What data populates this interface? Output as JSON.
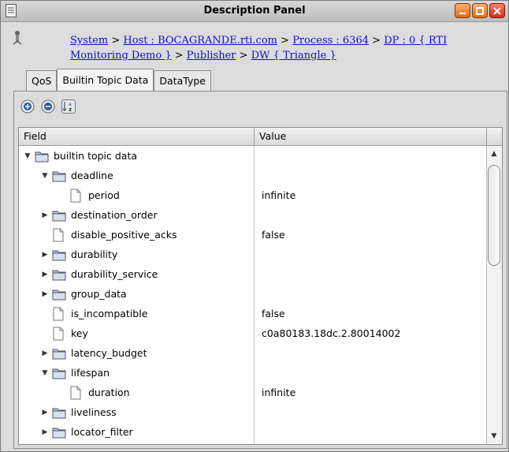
{
  "window": {
    "title": "Description Panel"
  },
  "breadcrumb": {
    "items": [
      "System",
      "Host : BOCAGRANDE.rti.com",
      "Process : 6364",
      "DP : 0 { RTI Monitoring Demo }",
      "Publisher",
      "DW { Triangle }"
    ],
    "separator": ">"
  },
  "tabs": [
    {
      "label": "QoS",
      "active": false
    },
    {
      "label": "Builtin Topic Data",
      "active": true
    },
    {
      "label": "DataType",
      "active": false
    }
  ],
  "toolbar": {
    "expand_icon": "plus-circle-icon",
    "collapse_icon": "minus-circle-icon",
    "sort_icon": "sort-az-icon"
  },
  "table": {
    "columns": [
      "Field",
      "Value"
    ],
    "rows": [
      {
        "indent": 0,
        "toggle": "expanded",
        "icon": "folder-icon",
        "field": "builtin topic data",
        "value": ""
      },
      {
        "indent": 1,
        "toggle": "expanded",
        "icon": "folder-icon",
        "field": "deadline",
        "value": ""
      },
      {
        "indent": 2,
        "toggle": "none",
        "icon": "file-icon",
        "field": "period",
        "value": "infinite"
      },
      {
        "indent": 1,
        "toggle": "collapsed",
        "icon": "folder-icon",
        "field": "destination_order",
        "value": ""
      },
      {
        "indent": 1,
        "toggle": "none",
        "icon": "file-icon",
        "field": "disable_positive_acks",
        "value": "false"
      },
      {
        "indent": 1,
        "toggle": "collapsed",
        "icon": "folder-icon",
        "field": "durability",
        "value": ""
      },
      {
        "indent": 1,
        "toggle": "collapsed",
        "icon": "folder-icon",
        "field": "durability_service",
        "value": ""
      },
      {
        "indent": 1,
        "toggle": "collapsed",
        "icon": "folder-icon",
        "field": "group_data",
        "value": ""
      },
      {
        "indent": 1,
        "toggle": "none",
        "icon": "file-icon",
        "field": "is_incompatible",
        "value": "false"
      },
      {
        "indent": 1,
        "toggle": "none",
        "icon": "file-icon",
        "field": "key",
        "value": "c0a80183.18dc.2.80014002"
      },
      {
        "indent": 1,
        "toggle": "collapsed",
        "icon": "folder-icon",
        "field": "latency_budget",
        "value": ""
      },
      {
        "indent": 1,
        "toggle": "expanded",
        "icon": "folder-icon",
        "field": "lifespan",
        "value": ""
      },
      {
        "indent": 2,
        "toggle": "none",
        "icon": "file-icon",
        "field": "duration",
        "value": "infinite"
      },
      {
        "indent": 1,
        "toggle": "collapsed",
        "icon": "folder-icon",
        "field": "liveliness",
        "value": ""
      },
      {
        "indent": 1,
        "toggle": "collapsed",
        "icon": "folder-icon",
        "field": "locator_filter",
        "value": ""
      }
    ]
  },
  "colors": {
    "link": "#1010d0",
    "window_button": "#e86a10",
    "close_button": "#d0301a",
    "folder": "#8aa0c8"
  }
}
